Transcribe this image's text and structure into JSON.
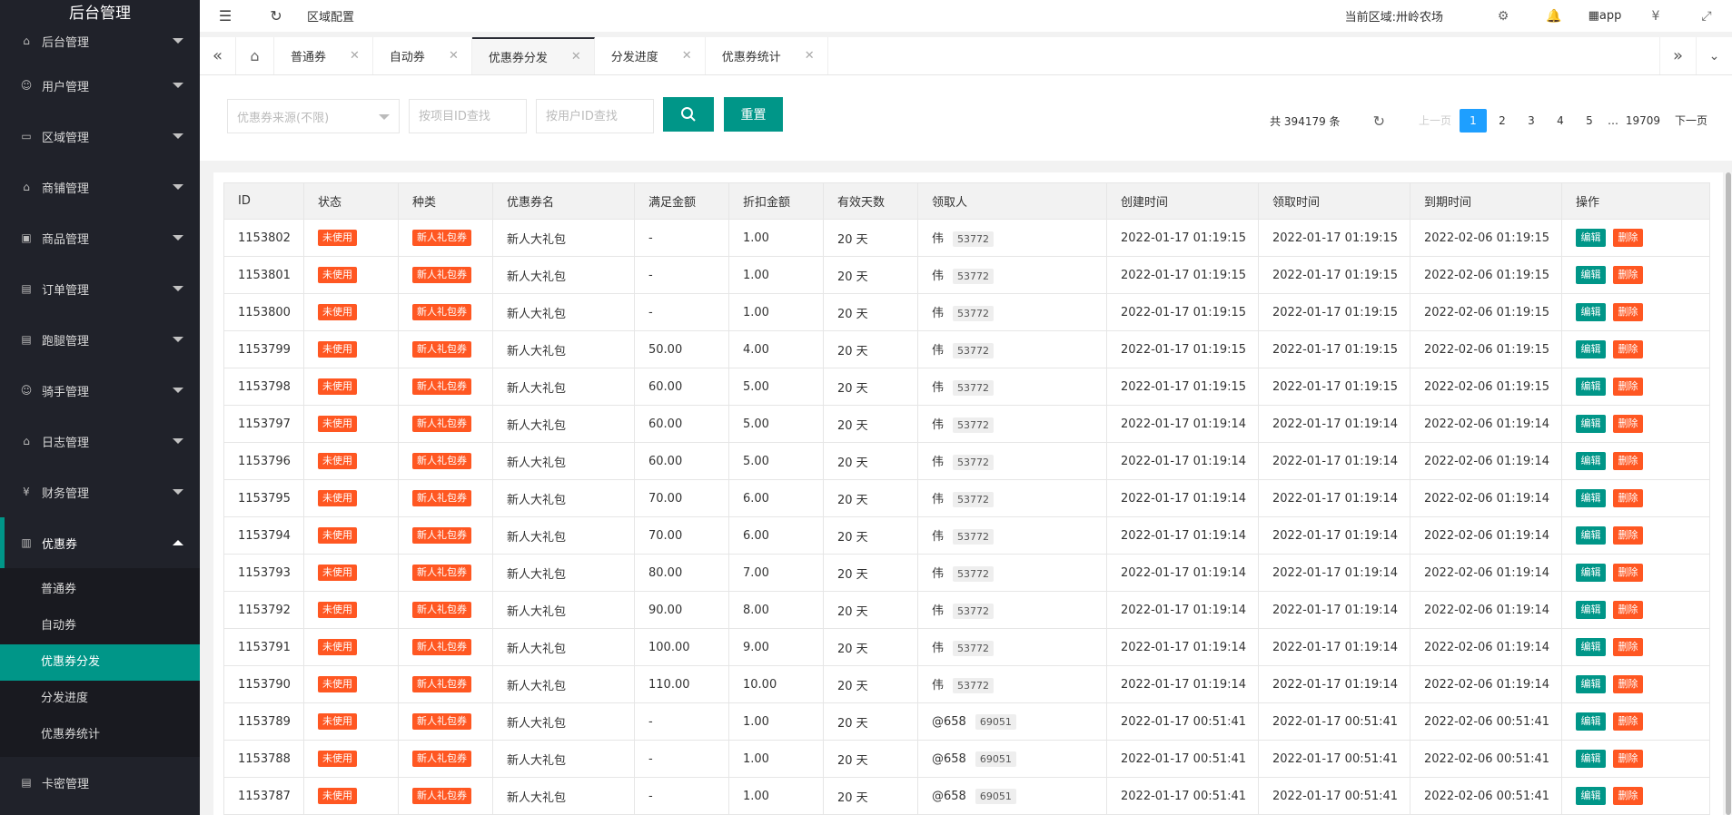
{
  "sidebar": {
    "title": "后台管理",
    "items": [
      {
        "label": "后台管理",
        "icon": "home-icon"
      },
      {
        "label": "用户管理",
        "icon": "user-icon"
      },
      {
        "label": "区域管理",
        "icon": "region-icon"
      },
      {
        "label": "商铺管理",
        "icon": "home-icon"
      },
      {
        "label": "商品管理",
        "icon": "goods-icon"
      },
      {
        "label": "订单管理",
        "icon": "order-icon"
      },
      {
        "label": "跑腿管理",
        "icon": "errand-icon"
      },
      {
        "label": "骑手管理",
        "icon": "rider-icon"
      },
      {
        "label": "日志管理",
        "icon": "home-icon"
      },
      {
        "label": "财务管理",
        "icon": "yen-icon"
      },
      {
        "label": "优惠券",
        "icon": "coupon-icon"
      }
    ],
    "sub_items": [
      "普通券",
      "自动券",
      "优惠券分发",
      "分发进度",
      "优惠券统计"
    ],
    "last_item": "卡密管理"
  },
  "header": {
    "breadcrumb": "区域配置",
    "region": "当前区域:卅岭农场",
    "app_label": "app"
  },
  "tabs": [
    "普通券",
    "自动券",
    "优惠券分发",
    "分发进度",
    "优惠券统计"
  ],
  "filter": {
    "source_placeholder": "优惠券来源(不限)",
    "project_placeholder": "按项目ID查找",
    "user_placeholder": "按用户ID查找",
    "reset_label": "重置"
  },
  "pager": {
    "total": "共 394179 条",
    "prev": "上一页",
    "pages": [
      "1",
      "2",
      "3",
      "4",
      "5"
    ],
    "dots": "…",
    "last": "19709",
    "next": "下一页"
  },
  "table": {
    "headers": [
      "ID",
      "状态",
      "种类",
      "优惠券名",
      "满足金额",
      "折扣金额",
      "有效天数",
      "领取人",
      "创建时间",
      "领取时间",
      "到期时间",
      "操作"
    ],
    "edit_label": "编辑",
    "delete_label": "删除",
    "rows": [
      {
        "id": "1153802",
        "status": "未使用",
        "kind": "新人礼包券",
        "name": "新人大礼包",
        "min": "-",
        "discount": "1.00",
        "days": "20 天",
        "user": "伟",
        "uid": "53772",
        "created": "2022-01-17 01:19:15",
        "claimed": "2022-01-17 01:19:15",
        "expire": "2022-02-06 01:19:15"
      },
      {
        "id": "1153801",
        "status": "未使用",
        "kind": "新人礼包券",
        "name": "新人大礼包",
        "min": "-",
        "discount": "1.00",
        "days": "20 天",
        "user": "伟",
        "uid": "53772",
        "created": "2022-01-17 01:19:15",
        "claimed": "2022-01-17 01:19:15",
        "expire": "2022-02-06 01:19:15"
      },
      {
        "id": "1153800",
        "status": "未使用",
        "kind": "新人礼包券",
        "name": "新人大礼包",
        "min": "-",
        "discount": "1.00",
        "days": "20 天",
        "user": "伟",
        "uid": "53772",
        "created": "2022-01-17 01:19:15",
        "claimed": "2022-01-17 01:19:15",
        "expire": "2022-02-06 01:19:15"
      },
      {
        "id": "1153799",
        "status": "未使用",
        "kind": "新人礼包券",
        "name": "新人大礼包",
        "min": "50.00",
        "discount": "4.00",
        "days": "20 天",
        "user": "伟",
        "uid": "53772",
        "created": "2022-01-17 01:19:15",
        "claimed": "2022-01-17 01:19:15",
        "expire": "2022-02-06 01:19:15"
      },
      {
        "id": "1153798",
        "status": "未使用",
        "kind": "新人礼包券",
        "name": "新人大礼包",
        "min": "60.00",
        "discount": "5.00",
        "days": "20 天",
        "user": "伟",
        "uid": "53772",
        "created": "2022-01-17 01:19:15",
        "claimed": "2022-01-17 01:19:15",
        "expire": "2022-02-06 01:19:15"
      },
      {
        "id": "1153797",
        "status": "未使用",
        "kind": "新人礼包券",
        "name": "新人大礼包",
        "min": "60.00",
        "discount": "5.00",
        "days": "20 天",
        "user": "伟",
        "uid": "53772",
        "created": "2022-01-17 01:19:14",
        "claimed": "2022-01-17 01:19:14",
        "expire": "2022-02-06 01:19:14"
      },
      {
        "id": "1153796",
        "status": "未使用",
        "kind": "新人礼包券",
        "name": "新人大礼包",
        "min": "60.00",
        "discount": "5.00",
        "days": "20 天",
        "user": "伟",
        "uid": "53772",
        "created": "2022-01-17 01:19:14",
        "claimed": "2022-01-17 01:19:14",
        "expire": "2022-02-06 01:19:14"
      },
      {
        "id": "1153795",
        "status": "未使用",
        "kind": "新人礼包券",
        "name": "新人大礼包",
        "min": "70.00",
        "discount": "6.00",
        "days": "20 天",
        "user": "伟",
        "uid": "53772",
        "created": "2022-01-17 01:19:14",
        "claimed": "2022-01-17 01:19:14",
        "expire": "2022-02-06 01:19:14"
      },
      {
        "id": "1153794",
        "status": "未使用",
        "kind": "新人礼包券",
        "name": "新人大礼包",
        "min": "70.00",
        "discount": "6.00",
        "days": "20 天",
        "user": "伟",
        "uid": "53772",
        "created": "2022-01-17 01:19:14",
        "claimed": "2022-01-17 01:19:14",
        "expire": "2022-02-06 01:19:14"
      },
      {
        "id": "1153793",
        "status": "未使用",
        "kind": "新人礼包券",
        "name": "新人大礼包",
        "min": "80.00",
        "discount": "7.00",
        "days": "20 天",
        "user": "伟",
        "uid": "53772",
        "created": "2022-01-17 01:19:14",
        "claimed": "2022-01-17 01:19:14",
        "expire": "2022-02-06 01:19:14"
      },
      {
        "id": "1153792",
        "status": "未使用",
        "kind": "新人礼包券",
        "name": "新人大礼包",
        "min": "90.00",
        "discount": "8.00",
        "days": "20 天",
        "user": "伟",
        "uid": "53772",
        "created": "2022-01-17 01:19:14",
        "claimed": "2022-01-17 01:19:14",
        "expire": "2022-02-06 01:19:14"
      },
      {
        "id": "1153791",
        "status": "未使用",
        "kind": "新人礼包券",
        "name": "新人大礼包",
        "min": "100.00",
        "discount": "9.00",
        "days": "20 天",
        "user": "伟",
        "uid": "53772",
        "created": "2022-01-17 01:19:14",
        "claimed": "2022-01-17 01:19:14",
        "expire": "2022-02-06 01:19:14"
      },
      {
        "id": "1153790",
        "status": "未使用",
        "kind": "新人礼包券",
        "name": "新人大礼包",
        "min": "110.00",
        "discount": "10.00",
        "days": "20 天",
        "user": "伟",
        "uid": "53772",
        "created": "2022-01-17 01:19:14",
        "claimed": "2022-01-17 01:19:14",
        "expire": "2022-02-06 01:19:14"
      },
      {
        "id": "1153789",
        "status": "未使用",
        "kind": "新人礼包券",
        "name": "新人大礼包",
        "min": "-",
        "discount": "1.00",
        "days": "20 天",
        "user": "@658",
        "uid": "69051",
        "created": "2022-01-17 00:51:41",
        "claimed": "2022-01-17 00:51:41",
        "expire": "2022-02-06 00:51:41"
      },
      {
        "id": "1153788",
        "status": "未使用",
        "kind": "新人礼包券",
        "name": "新人大礼包",
        "min": "-",
        "discount": "1.00",
        "days": "20 天",
        "user": "@658",
        "uid": "69051",
        "created": "2022-01-17 00:51:41",
        "claimed": "2022-01-17 00:51:41",
        "expire": "2022-02-06 00:51:41"
      },
      {
        "id": "1153787",
        "status": "未使用",
        "kind": "新人礼包券",
        "name": "新人大礼包",
        "min": "-",
        "discount": "1.00",
        "days": "20 天",
        "user": "@658",
        "uid": "69051",
        "created": "2022-01-17 00:51:41",
        "claimed": "2022-01-17 00:51:41",
        "expire": "2022-02-06 00:51:41"
      }
    ]
  },
  "colors": {
    "accent": "#009688",
    "danger": "#ff5722",
    "page_active": "#1e9fff",
    "sidebar_bg": "#20222a"
  }
}
